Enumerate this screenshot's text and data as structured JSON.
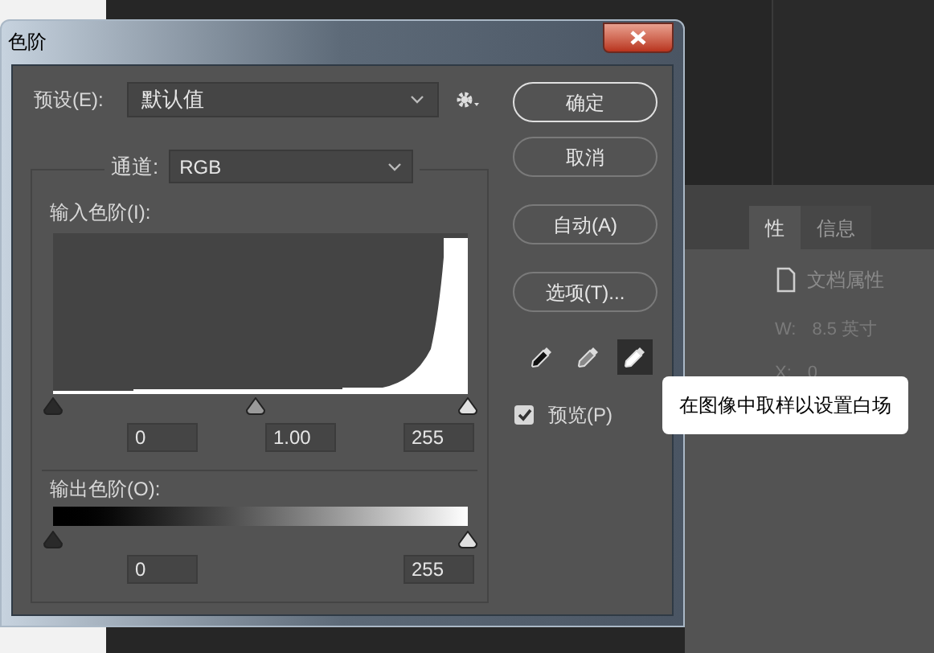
{
  "window": {
    "title": "色阶"
  },
  "preset": {
    "label": "预设(E):",
    "value": "默认值"
  },
  "channel": {
    "label": "通道:",
    "value": "RGB"
  },
  "input_levels": {
    "label": "输入色阶(I):",
    "handles": [
      {
        "kind": "black",
        "level": 0
      },
      {
        "kind": "gray",
        "level": 0.49
      },
      {
        "kind": "white",
        "level": 1
      }
    ],
    "fields": [
      "0",
      "1.00",
      "255"
    ]
  },
  "output_levels": {
    "label": "输出色阶(O):",
    "handles": [
      {
        "kind": "black",
        "level": 0
      },
      {
        "kind": "white",
        "level": 1
      }
    ],
    "fields": [
      "0",
      "255"
    ]
  },
  "buttons": [
    {
      "label": "确定",
      "focused": true
    },
    {
      "label": "取消",
      "focused": false
    },
    {
      "label": "自动(A)",
      "focused": false
    },
    {
      "label": "选项(T)...",
      "focused": false
    }
  ],
  "eyedroppers": [
    {
      "kind": "black",
      "selected": false
    },
    {
      "kind": "gray",
      "selected": false
    },
    {
      "kind": "white",
      "selected": true
    }
  ],
  "preview": {
    "label": "预览(P)",
    "checked": true
  },
  "tooltip": "在图像中取样以设置白场",
  "properties_panel": {
    "tabs": [
      {
        "label": "性",
        "selected": true
      },
      {
        "label": "信息",
        "selected": false
      }
    ],
    "doc_label": "文档属性",
    "rows": [
      {
        "label": "W:",
        "value": "8.5 英寸"
      },
      {
        "label": "X:",
        "value": "0"
      }
    ]
  }
}
